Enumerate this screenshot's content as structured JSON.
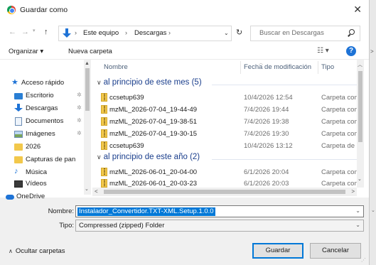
{
  "window": {
    "title": "Guardar como",
    "close_glyph": "✕"
  },
  "address_bar": {
    "back_glyph": "←",
    "forward_glyph": "→",
    "up_glyph": "↑",
    "crumbs": [
      "Este equipo",
      "Descargas"
    ],
    "crumb_separator": "›",
    "refresh_glyph": "↻"
  },
  "search": {
    "placeholder": "Buscar en Descargas"
  },
  "toolbar": {
    "organize_label": "Organizar ▾",
    "new_folder_label": "Nueva carpeta",
    "view_glyph": "☷ ▾",
    "help_glyph": "?"
  },
  "nav_pane": {
    "items": [
      {
        "label": "Acceso rápido",
        "icon": "star-icon",
        "pinned": false
      },
      {
        "label": "Escritorio",
        "icon": "desktop-icon",
        "pinned": true
      },
      {
        "label": "Descargas",
        "icon": "download-icon",
        "pinned": true
      },
      {
        "label": "Documentos",
        "icon": "document-icon",
        "pinned": true
      },
      {
        "label": "Imágenes",
        "icon": "image-icon",
        "pinned": true
      },
      {
        "label": "2026",
        "icon": "folder-icon",
        "pinned": false
      },
      {
        "label": "Capturas de pan",
        "icon": "folder-icon",
        "pinned": false
      },
      {
        "label": "Música",
        "icon": "music-icon",
        "pinned": false
      },
      {
        "label": "Vídeos",
        "icon": "video-icon",
        "pinned": false
      },
      {
        "label": "OneDrive",
        "icon": "cloud-icon",
        "pinned": false
      }
    ],
    "pin_glyph": "✲"
  },
  "file_list": {
    "columns": {
      "name": "Nombre",
      "date": "Fecha de modificación",
      "type": "Tipo"
    },
    "groups": [
      {
        "label": "al principio de este mes (5)",
        "rows": [
          {
            "name": "ccsetup639",
            "date": "10/4/2026 12:54",
            "type": "Carpeta com"
          },
          {
            "name": "mzML_2026-07-04_19-44-49",
            "date": "7/4/2026 19:44",
            "type": "Carpeta com"
          },
          {
            "name": "mzML_2026-07-04_19-38-51",
            "date": "7/4/2026 19:38",
            "type": "Carpeta com"
          },
          {
            "name": "mzML_2026-07-04_19-30-15",
            "date": "7/4/2026 19:30",
            "type": "Carpeta com"
          },
          {
            "name": "ccsetup639",
            "date": "10/4/2026 13:12",
            "type": "Carpeta de ar"
          }
        ]
      },
      {
        "label": "al principio de este año (2)",
        "rows": [
          {
            "name": "mzML_2026-06-01_20-04-00",
            "date": "6/1/2026 20:04",
            "type": "Carpeta com"
          },
          {
            "name": "mzML_2026-06-01_20-03-23",
            "date": "6/1/2026 20:03",
            "type": "Carpeta com"
          }
        ]
      }
    ]
  },
  "form": {
    "filename_label": "Nombre:",
    "filename_value": "Instalador_Convertidor.TXT-XML.Setup.1.0.0",
    "type_label": "Tipo:",
    "type_value": "Compressed (zipped) Folder"
  },
  "footer": {
    "hide_folders_label": "Ocultar carpetas",
    "save_label": "Guardar",
    "cancel_label": "Cancelar"
  }
}
